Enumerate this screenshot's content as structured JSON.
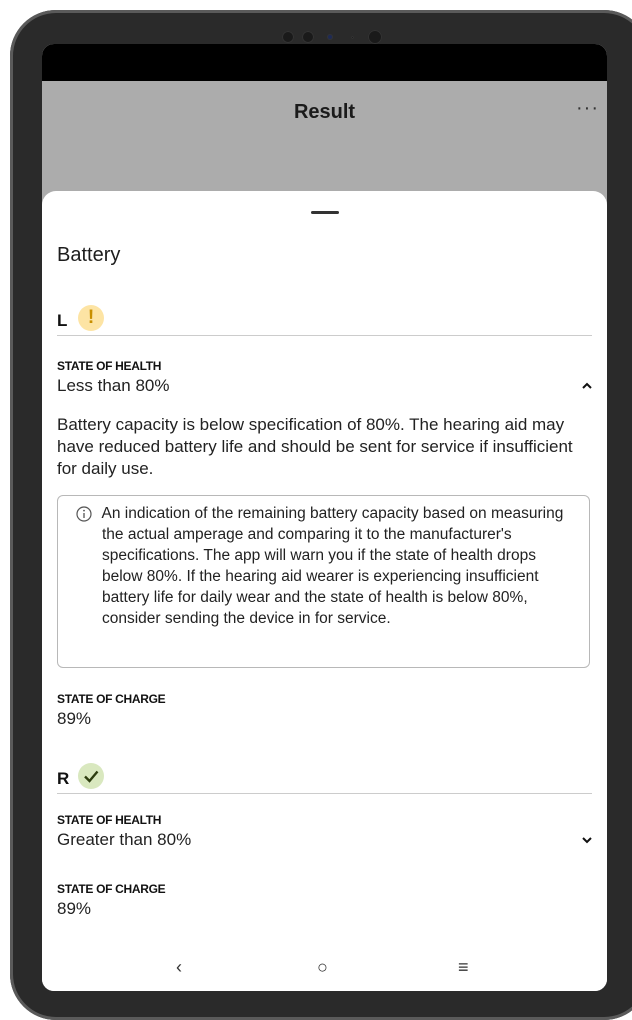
{
  "header": {
    "title": "Result",
    "more_label": "···"
  },
  "sheet": {
    "title": "Battery",
    "left": {
      "side_label": "L",
      "status_icon": "warning-icon",
      "status_glyph": "!",
      "health": {
        "label": "STATE OF HEALTH",
        "value": "Less than 80%",
        "expanded": true,
        "description": "Battery capacity is below specification of 80%. The hearing aid may have reduced battery life and should be sent for service if insufficient for daily use.",
        "info": "An indication of the remaining battery capacity based on measuring the actual amperage and comparing it to the manufacturer's specifications. The app will warn you if the state of health drops below 80%. If the hearing aid wearer is experiencing insufficient battery life for daily wear and the state of health is below 80%, consider sending the device in for service."
      },
      "charge": {
        "label": "STATE OF CHARGE",
        "value": "89%"
      }
    },
    "right": {
      "side_label": "R",
      "status_icon": "check-icon",
      "health": {
        "label": "STATE OF HEALTH",
        "value": "Greater than 80%",
        "expanded": false
      },
      "charge": {
        "label": "STATE OF CHARGE",
        "value": "89%"
      }
    }
  },
  "nav": {
    "back": "‹",
    "home": "○",
    "recents": "≡"
  },
  "colors": {
    "header_bg": "#acacac",
    "alert_strip": "#b58383",
    "warning_bg": "#fde4a4",
    "warning_fg": "#c88f00",
    "ok_bg": "#d9e8bf",
    "ok_fg": "#2d3d0f"
  }
}
